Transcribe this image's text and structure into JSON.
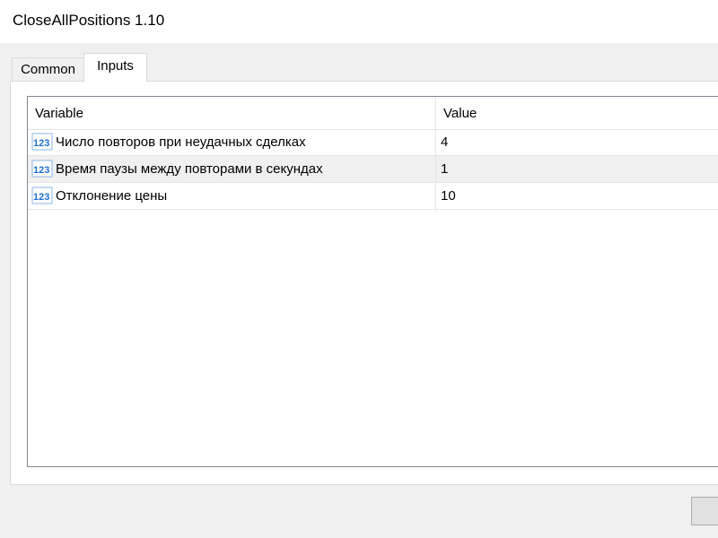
{
  "window": {
    "title": "CloseAllPositions 1.10"
  },
  "tabs": [
    {
      "label": "Common"
    },
    {
      "label": "Inputs"
    }
  ],
  "grid": {
    "columns": {
      "variable": "Variable",
      "value": "Value"
    },
    "rows": [
      {
        "icon": "numeric-123-icon",
        "name": "Число повторов при неудачных сделках",
        "value": "4"
      },
      {
        "icon": "numeric-123-icon",
        "name": "Время паузы между повторами в секундах",
        "value": "1"
      },
      {
        "icon": "numeric-123-icon",
        "name": "Отклонение цены",
        "value": "10"
      }
    ]
  },
  "colors": {
    "window_bg": "#f0f0f0",
    "panel_bg": "#ffffff",
    "alt_row_bg": "#f0f0f0",
    "icon_blue": "#1f6fd0"
  }
}
